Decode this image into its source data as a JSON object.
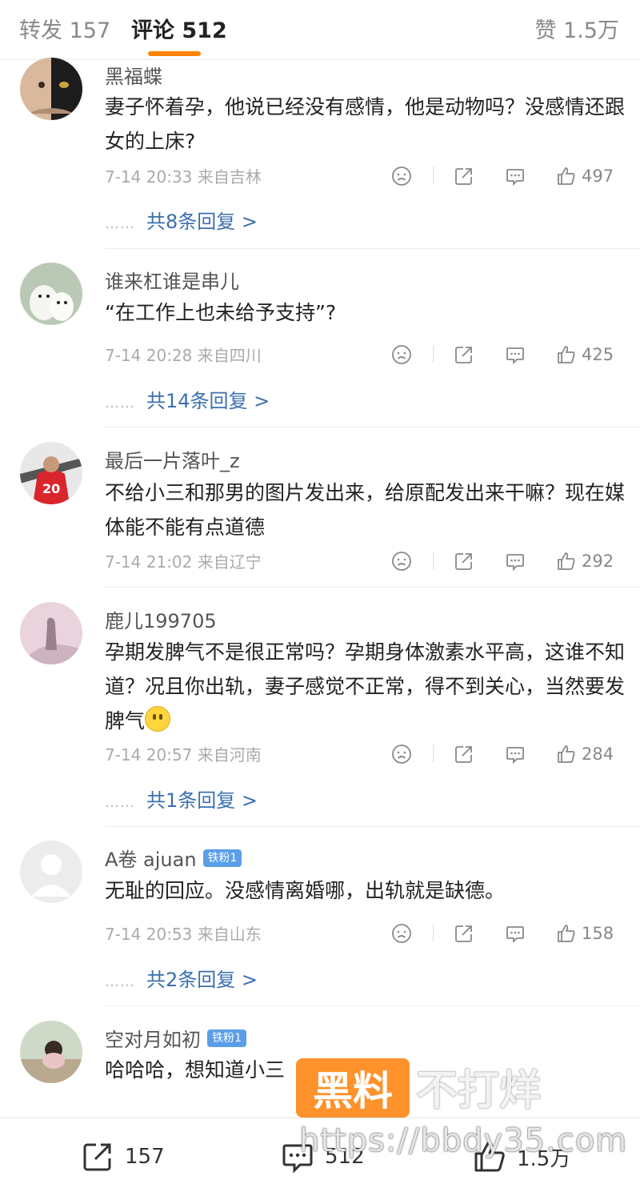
{
  "tabs": {
    "repost": "转发 157",
    "comment": "评论 512",
    "like": "赞 1.5万"
  },
  "colors": {
    "accent": "#ff8200",
    "link": "#3a6fb0",
    "badge": "#5a9ee8",
    "watermark": "#ff8a1c"
  },
  "comments": [
    {
      "user": "黑福蝶",
      "text": "妻子怀着孕，他说已经没有感情，他是动物吗？没感情还跟女的上床?",
      "time": "7-14 20:33 来自吉林",
      "likes": "497",
      "replies": "共8条回复 >"
    },
    {
      "user": "谁来杠谁是串儿",
      "text": "“在工作上也未给予支持”?",
      "time": "7-14 20:28 来自四川",
      "likes": "425",
      "replies": "共14条回复 >"
    },
    {
      "user": "最后一片落叶_z",
      "text": "不给小三和那男的图片发出来，给原配发出来干嘛？现在媒体能不能有点道德",
      "time": "7-14 21:02 来自辽宁",
      "likes": "292"
    },
    {
      "user": "鹿儿199705",
      "text": "孕期发脾气不是很正常吗？孕期身体激素水平高，这谁不知道？况且你出轨，妻子感觉不正常，得不到关心，当然要发脾气",
      "time": "7-14 20:57 来自河南",
      "likes": "284",
      "replies": "共1条回复 >"
    },
    {
      "user": "A卷 ajuan",
      "badge": "铁粉1",
      "text": "无耻的回应。没感情离婚哪，出轨就是缺德。",
      "time": "7-14 20:53 来自山东",
      "likes": "158",
      "replies": "共2条回复 >"
    },
    {
      "user": "空对月如初",
      "badge": "铁粉1",
      "text": "哈哈哈，想知道小三"
    }
  ],
  "reply_dots": "……",
  "icons": [
    "dislike-face-icon",
    "share-icon",
    "reply-icon",
    "thumb-up-icon"
  ],
  "bottom": {
    "repost": "157",
    "comment": "512",
    "like": "1.5万"
  },
  "watermark": {
    "brand": "黑料",
    "text": "不打烊",
    "url": "https://bbdy35.com"
  }
}
